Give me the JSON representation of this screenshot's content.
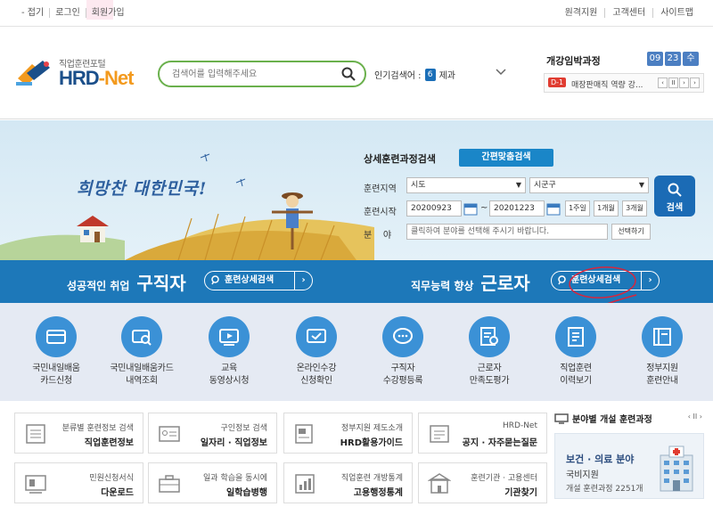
{
  "topbar": {
    "left": [
      "- 접기",
      "로그인",
      "회원가입"
    ],
    "right": [
      "원격지원",
      "고객센터",
      "사이트맵"
    ]
  },
  "logo": {
    "sub": "직업훈련포털",
    "main_a": "HRD",
    "main_b": "-Net"
  },
  "search": {
    "placeholder": "검색어를 입력해주세요"
  },
  "popular": {
    "label": "인기검색어 :",
    "rank": "6",
    "keyword": "제과"
  },
  "deadline": {
    "title": "개강임박과정",
    "clock": [
      "09",
      "23",
      "수"
    ],
    "dday": "D-1",
    "course": "매장판매직 역량 강...",
    "controls": [
      "‹",
      "II",
      "›",
      "›"
    ]
  },
  "hero": {
    "slogan": "희망찬 대한민국!",
    "detail_title": "상세훈련과정검색",
    "easy_btn": "간편맞춤검색",
    "region_label": "훈련지역",
    "region_sido": "시도",
    "region_sigungu": "시군구",
    "start_label": "훈련시작",
    "date_from": "20200923",
    "date_sep": "~",
    "date_to": "20201223",
    "periods": [
      "1주일",
      "1개월",
      "3개월"
    ],
    "field_label": "분    야",
    "field_placeholder": "클릭하여 분야를 선택해 주시기 바랍니다.",
    "select_btn": "선택하기",
    "search_btn": "검색"
  },
  "band": {
    "seeker_small": "성공적인 취업",
    "seeker_large": "구직자",
    "seeker_btn": "훈련상세검색",
    "worker_small": "직무능력 향상",
    "worker_large": "근로자",
    "worker_btn": "훈련상세검색"
  },
  "services": [
    {
      "l1": "국민내일배움",
      "l2": "카드신청",
      "icon": "card-icon"
    },
    {
      "l1": "국민내일배움카드",
      "l2": "내역조회",
      "icon": "card-search-icon"
    },
    {
      "l1": "교육",
      "l2": "동영상시청",
      "icon": "video-icon"
    },
    {
      "l1": "온라인수강",
      "l2": "신청확인",
      "icon": "online-check-icon"
    },
    {
      "l1": "구직자",
      "l2": "수강평등록",
      "icon": "chat-icon"
    },
    {
      "l1": "근로자",
      "l2": "만족도평가",
      "icon": "survey-icon"
    },
    {
      "l1": "직업훈련",
      "l2": "이력보기",
      "icon": "history-icon"
    },
    {
      "l1": "정부지원",
      "l2": "훈련안내",
      "icon": "book-icon"
    }
  ],
  "infos": [
    {
      "t1": "분류별 훈련정보 검색",
      "t2": "직업훈련정보",
      "icon": "list-icon"
    },
    {
      "t1": "구인정보 검색",
      "t2": "일자리 · 직업정보",
      "icon": "idcard-icon"
    },
    {
      "t1": "정부지원 제도소개",
      "t2": "HRD활용가이드",
      "icon": "guide-icon"
    },
    {
      "t1": "HRD-Net",
      "t2": "공지 · 자주묻는질문",
      "icon": "notice-icon"
    },
    {
      "t1": "민원신청서식",
      "t2": "다운로드",
      "icon": "download-icon"
    },
    {
      "t1": "일과 학습을 동시에",
      "t2": "일학습병행",
      "icon": "briefcase-icon"
    },
    {
      "t1": "직업훈련 개방통계",
      "t2": "고용행정통계",
      "icon": "stats-icon"
    },
    {
      "t1": "훈련기관 · 고용센터",
      "t2": "기관찾기",
      "icon": "building-icon"
    }
  ],
  "field_box": {
    "title": "분야별 개설 훈련과정",
    "nav": "‹ II ›",
    "category": "보건 · 의료 분야",
    "sub": "국비지원",
    "count": "개설 훈련과정 2251개"
  },
  "colors": {
    "primary": "#1d78b9",
    "accent_orange": "#f39a1e",
    "annotation": "#d7263d"
  }
}
